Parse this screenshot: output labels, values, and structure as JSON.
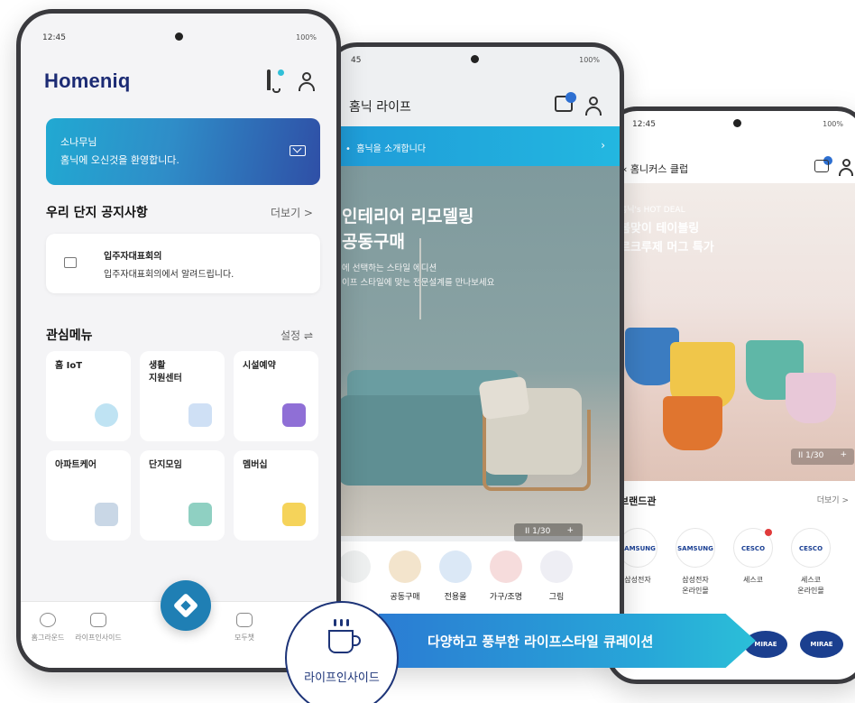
{
  "front": {
    "status": {
      "time": "12:45",
      "sys": "100%"
    },
    "logo": "Homeniq",
    "banner": {
      "line1": "소나무님",
      "line2": "홈닉에 오신것을 환영합니다."
    },
    "notice": {
      "title": "우리 단지 공지사항",
      "more": "더보기 >",
      "item_title": "입주자대표회의",
      "item_body": "입주자대표회의에서 알려드립니다."
    },
    "menu": {
      "title": "관심메뉴",
      "settings": "설정",
      "tiles": [
        {
          "label": "홈 IoT"
        },
        {
          "label": "생활\n지원센터"
        },
        {
          "label": "시설예약"
        },
        {
          "label": "아파트케어"
        },
        {
          "label": "단지모임"
        },
        {
          "label": "멤버십"
        }
      ]
    },
    "bottom_nav": [
      {
        "label": "홈그라운드"
      },
      {
        "label": "라이프인사이드"
      },
      {
        "label": ""
      },
      {
        "label": "모두챗"
      }
    ]
  },
  "middle": {
    "status": {
      "time": "45",
      "sys": "100%"
    },
    "title": "홈닉 라이프",
    "strip": "홈닉을 소개합니다",
    "hero": {
      "headline1": "인테리어 리모델링",
      "headline2": "공동구매",
      "sub1": "에 선택하는 스타일 에디션",
      "sub2": "이프 스타일에 맞는 전문설계를 만나보세요"
    },
    "pager": "1/30",
    "categories": [
      {
        "label": ""
      },
      {
        "label": "공동구매"
      },
      {
        "label": "전용몰"
      },
      {
        "label": "가구/조명"
      },
      {
        "label": "그림"
      }
    ]
  },
  "back": {
    "status": {
      "time": "12:45",
      "sys": "100%"
    },
    "title": "홈니커스 클럽",
    "hero": {
      "deal": "홈닉's HOT DEAL",
      "headline1": "봄맞이 테이블링",
      "headline2": "르크루제 머그 특가"
    },
    "pager": "1/30",
    "brand_title": "브랜드관",
    "brand_more": "더보기 >",
    "brands": [
      {
        "logo": "SAMSUNG",
        "name": "삼성전자"
      },
      {
        "logo": "SAMSUNG",
        "name": "삼성전자\n온라인몰"
      },
      {
        "logo": "CESCO",
        "name": "세스코"
      },
      {
        "logo": "CESCO",
        "name": "세스코\n온라인몰"
      }
    ],
    "mirae": [
      "MIRAE",
      "MIRAE"
    ]
  },
  "callout": {
    "label": "라이프인사이드",
    "text": "다양하고 풍부한 라이프스타일 큐레이션"
  },
  "colors": {
    "brand_navy": "#1c2b74",
    "accent_blue": "#1f7fb4",
    "banner_start": "#21a9d2",
    "banner_end": "#2f4fa6"
  }
}
